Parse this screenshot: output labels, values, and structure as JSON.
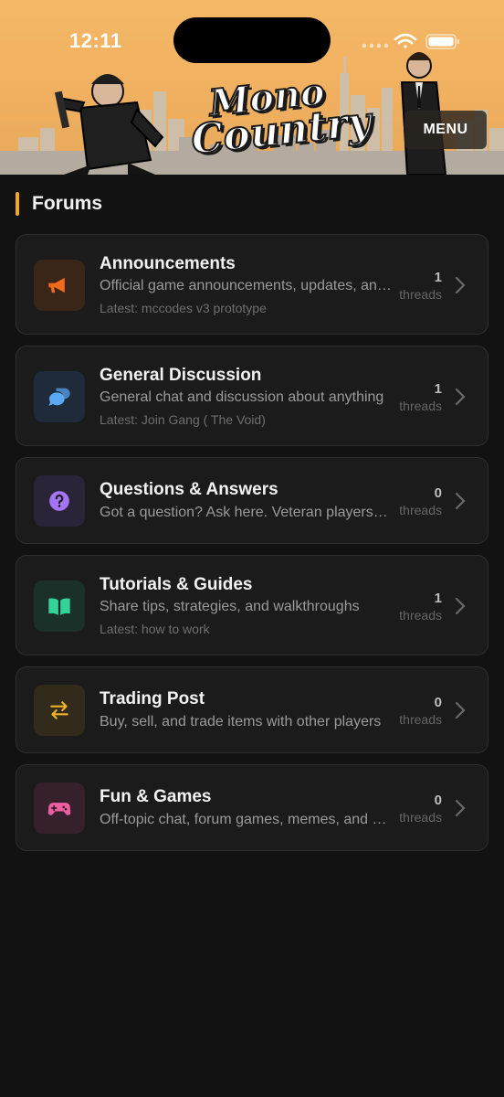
{
  "status_bar": {
    "time": "12:11"
  },
  "header": {
    "logo_line1": "Mono",
    "logo_line2": "Country",
    "menu_label": "MENU"
  },
  "section": {
    "title": "Forums"
  },
  "forums": [
    {
      "name": "Announcements",
      "description": "Official game announcements, updates, and news",
      "latest": "Latest: mccodes v3 prototype",
      "count": "1",
      "count_label": "threads",
      "icon": "megaphone-icon",
      "accent": "#f26a1b",
      "icon_bg": "#3a2519"
    },
    {
      "name": "General Discussion",
      "description": "General chat and discussion about anything",
      "latest": "Latest: Join Gang ( The Void)",
      "count": "1",
      "count_label": "threads",
      "icon": "chat-bubbles-icon",
      "accent": "#5aa9f5",
      "icon_bg": "#1f2a3a"
    },
    {
      "name": "Questions & Answers",
      "description": "Got a question? Ask here. Veteran players can help",
      "latest": "",
      "count": "0",
      "count_label": "threads",
      "icon": "question-circle-icon",
      "accent": "#a374f5",
      "icon_bg": "#2a2438"
    },
    {
      "name": "Tutorials & Guides",
      "description": "Share tips, strategies, and walkthroughs",
      "latest": "Latest: how to work",
      "count": "1",
      "count_label": "threads",
      "icon": "open-book-icon",
      "accent": "#34d39a",
      "icon_bg": "#1b3029"
    },
    {
      "name": "Trading Post",
      "description": "Buy, sell, and trade items with other players",
      "latest": "",
      "count": "0",
      "count_label": "threads",
      "icon": "swap-arrows-icon",
      "accent": "#f0b429",
      "icon_bg": "#322a1a"
    },
    {
      "name": "Fun & Games",
      "description": "Off-topic chat, forum games, memes, and more",
      "latest": "",
      "count": "0",
      "count_label": "threads",
      "icon": "gamepad-icon",
      "accent": "#ee5ea0",
      "icon_bg": "#35202b"
    }
  ]
}
